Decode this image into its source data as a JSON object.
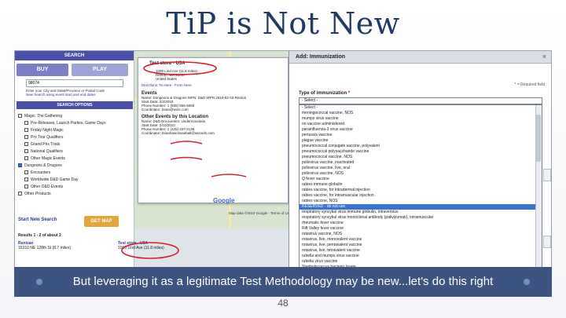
{
  "slide": {
    "title": "TiP is Not New",
    "caption": "But leveraging it as a legitimate Test Methodology may be new...let's do this right",
    "page_number": "48"
  },
  "left_panel": {
    "header": "SEARCH",
    "buy_label": "BUY",
    "play_label": "PLAY",
    "wizards_label": "Wizards Play Network",
    "zip_value": "98074",
    "zip_help": "Enter your City and State/Province or Postal Code",
    "recent_link": "New Search using event start and end dates",
    "search_options_header": "SEARCH OPTIONS",
    "filters": [
      {
        "label": "Magic: The Gathering",
        "checked": false,
        "sub": false
      },
      {
        "label": "Pre-Releases, Launch Parties, Game Days",
        "checked": false,
        "sub": true
      },
      {
        "label": "Friday Night Magic",
        "checked": false,
        "sub": true
      },
      {
        "label": "Pro Tour Qualifiers",
        "checked": false,
        "sub": true
      },
      {
        "label": "Grand Prix Trials",
        "checked": false,
        "sub": true
      },
      {
        "label": "National Qualifiers",
        "checked": false,
        "sub": true
      },
      {
        "label": "Other Magic Events",
        "checked": false,
        "sub": true
      },
      {
        "label": "Dungeons & Dragons",
        "checked": true,
        "sub": false
      },
      {
        "label": "Encounters",
        "checked": false,
        "sub": true
      },
      {
        "label": "Worldwide D&D Game Day",
        "checked": false,
        "sub": true
      },
      {
        "label": "Other D&D Events",
        "checked": false,
        "sub": true
      },
      {
        "label": "Other Products",
        "checked": false,
        "sub": false
      }
    ],
    "start_new_search": "Start New Search",
    "get_map": "GET MAP",
    "results_header": "Results 1 - 2 of about 2",
    "results": [
      {
        "name": "Rentzan",
        "address": "15310 NE 128th St (8.7 miles)"
      },
      {
        "name": "Test store - U3A",
        "address": "1000 Lind Ave (11.8 miles)"
      }
    ]
  },
  "map_popup": {
    "store_title": "Test store - U3A",
    "address": "1000 Lind Ave (11.8 miles)",
    "city": "Renton, WA 98057",
    "country": "United States",
    "directions": "Directions: To Here - From Here",
    "events_header": "Events",
    "event1_name": "Name: Dungeons & Dragons WPN: D&D WPN 2010-02-03-Renton",
    "event1_date": "Start Date: 2/2/2010",
    "event1_phone": "Phone Number: 1 (555) 555-5555",
    "event1_coord": "Coordinator: brian@wotc.com",
    "other_events": "Other Events by this Location",
    "event2_name": "Name: D&D Encounters: Undermountain",
    "event2_date": "Start Date: 2/10/2010",
    "event2_phone": "Phone Number: 1 (425) 337-2136",
    "event2_coord": "Coordinator: brianbasicbaseball@wizards.com",
    "map_credit": "Map data ©2010 Google - Terms of Use",
    "google": "Google"
  },
  "dialog": {
    "title": "Add: Immunization",
    "close_glyph": "×",
    "required_note": "* = Required field",
    "type_label": "Type of immunization",
    "required_star": "*",
    "selected_value": "- Select -",
    "options": [
      "- Select -",
      "meningococcal vaccine, NOS",
      "mumps virus vaccine",
      "no vaccine administered",
      "parainfluenza-3 virus vaccine",
      "pertussis vaccine",
      "plague vaccine",
      "pneumococcal conjugate vaccine, polyvalent",
      "pneumococcal polysaccharide vaccine",
      "pneumococcal vaccine, NOS",
      "poliovirus vaccine, inactivated",
      "poliovirus vaccine, live, oral",
      "poliovirus vaccine, NOS",
      "Q fever vaccine",
      "rabies immune globulin",
      "rabies vaccine, for intradermal injection",
      "rabies vaccine, for intramuscular injection",
      "rabies vaccine, NOS",
      "RESERVED - do not use",
      "respiratory syncytial virus immune globulin, intravenous",
      "respiratory syncytial virus monoclonal antibody (palivizumab), intramuscular",
      "rheumatic fever vaccine",
      "Rift Valley fever vaccine",
      "rotavirus vaccine, NOS",
      "rotavirus, live, monovalent vaccine",
      "rotavirus, live, pentavalent vaccine",
      "rotavirus, live, tetravalent vaccine",
      "rubella and mumps virus vaccine",
      "rubella virus vaccine",
      "Staphylococcus bacterio lysate"
    ],
    "highlighted_index": 18
  }
}
